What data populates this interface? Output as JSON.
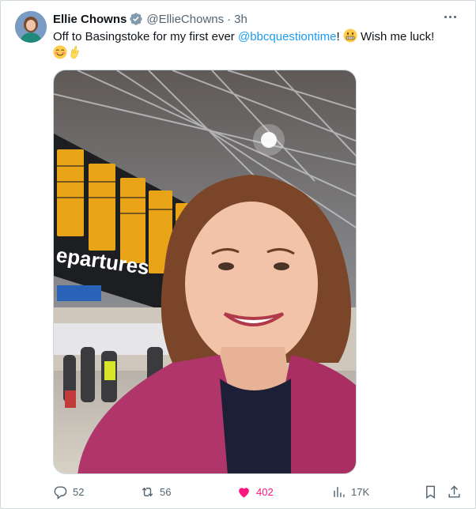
{
  "author": {
    "name": "Ellie Chowns",
    "handle": "@EllieChowns",
    "separator": "·",
    "time": "3h"
  },
  "tweet": {
    "text_before": "Off to Basingstoke for my first ever ",
    "mention": "@bbcquestiontime",
    "text_after": "! ",
    "text_end": " Wish me luck!",
    "emojis": [
      "grimacing-emoji",
      "smiling-blush-emoji",
      "crossed-fingers-emoji"
    ]
  },
  "photo": {
    "departures_sign": "epartures"
  },
  "actions": {
    "replies": "52",
    "retweets": "56",
    "likes": "402",
    "views": "17K"
  },
  "colors": {
    "accent": "#1d9bf0",
    "like": "#f91880",
    "secondary_text": "#536471",
    "border": "#cfd9de"
  },
  "icons": [
    "verified-badge-icon",
    "more-icon",
    "reply-icon",
    "retweet-icon",
    "heart-icon",
    "views-icon",
    "bookmark-icon",
    "share-icon"
  ]
}
